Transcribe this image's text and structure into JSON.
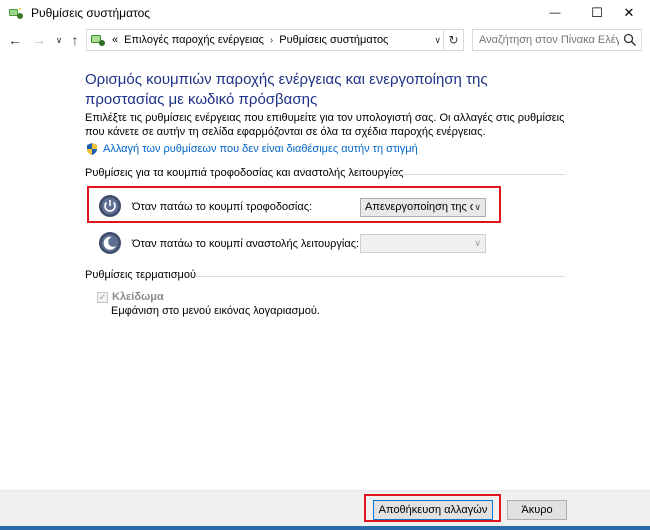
{
  "window": {
    "title": "Ρυθμίσεις συστήματος",
    "minimize_glyph": "—",
    "maximize_glyph": "☐",
    "close_glyph": "✕"
  },
  "nav": {
    "back_glyph": "←",
    "forward_glyph": "→",
    "recent_glyph": "∨",
    "up_glyph": "↑",
    "breadcrumb_prefix": "«",
    "breadcrumb": [
      "Επιλογές παροχής ενέργειας",
      "Ρυθμίσεις συστήματος"
    ],
    "breadcrumb_sep": "›",
    "dropdown_glyph": "∨",
    "refresh_glyph": "↻",
    "search_placeholder": "Αναζήτηση στον Πίνακα Ελέγ..."
  },
  "content": {
    "heading": "Ορισμός κουμπιών παροχής ενέργειας και ενεργοποίηση της προστασίας με κωδικό πρόσβασης",
    "description": "Επιλέξτε τις ρυθμίσεις ενέργειας που επιθυμείτε για τον υπολογιστή σας. Οι αλλαγές στις ρυθμίσεις που κάνετε σε αυτήν τη σελίδα εφαρμόζονται σε όλα τα σχέδια παροχής ενέργειας.",
    "change_link": "Αλλαγή των ρυθμίσεων που δεν είναι διαθέσιμες αυτήν τη στιγμή"
  },
  "buttons_section": {
    "title": "Ρυθμίσεις για τα κουμπιά τροφοδοσίας και αναστολής λειτουργίας",
    "power_label": "Όταν πατάω το κουμπί τροφοδοσίας:",
    "power_value": "Απενεργοποίηση της σ",
    "sleep_label": "Όταν πατάω το κουμπί αναστολής λειτουργίας:",
    "sleep_value": ""
  },
  "shutdown_section": {
    "title": "Ρυθμίσεις τερματισμού",
    "lock_label": "Κλείδωμα",
    "lock_checked": true,
    "lock_description": "Εμφάνιση στο μενού εικόνας λογαριασμού."
  },
  "footer": {
    "save_label": "Αποθήκευση αλλαγών",
    "cancel_label": "Άκυρο"
  },
  "colors": {
    "heading": "#1e3287",
    "link": "#0066cc",
    "highlight": "#e0141e"
  },
  "icons": [
    "power-options-icon",
    "control-panel-icon",
    "search-icon",
    "uac-shield-icon",
    "power-button-icon",
    "sleep-button-icon",
    "checkmark-icon"
  ]
}
